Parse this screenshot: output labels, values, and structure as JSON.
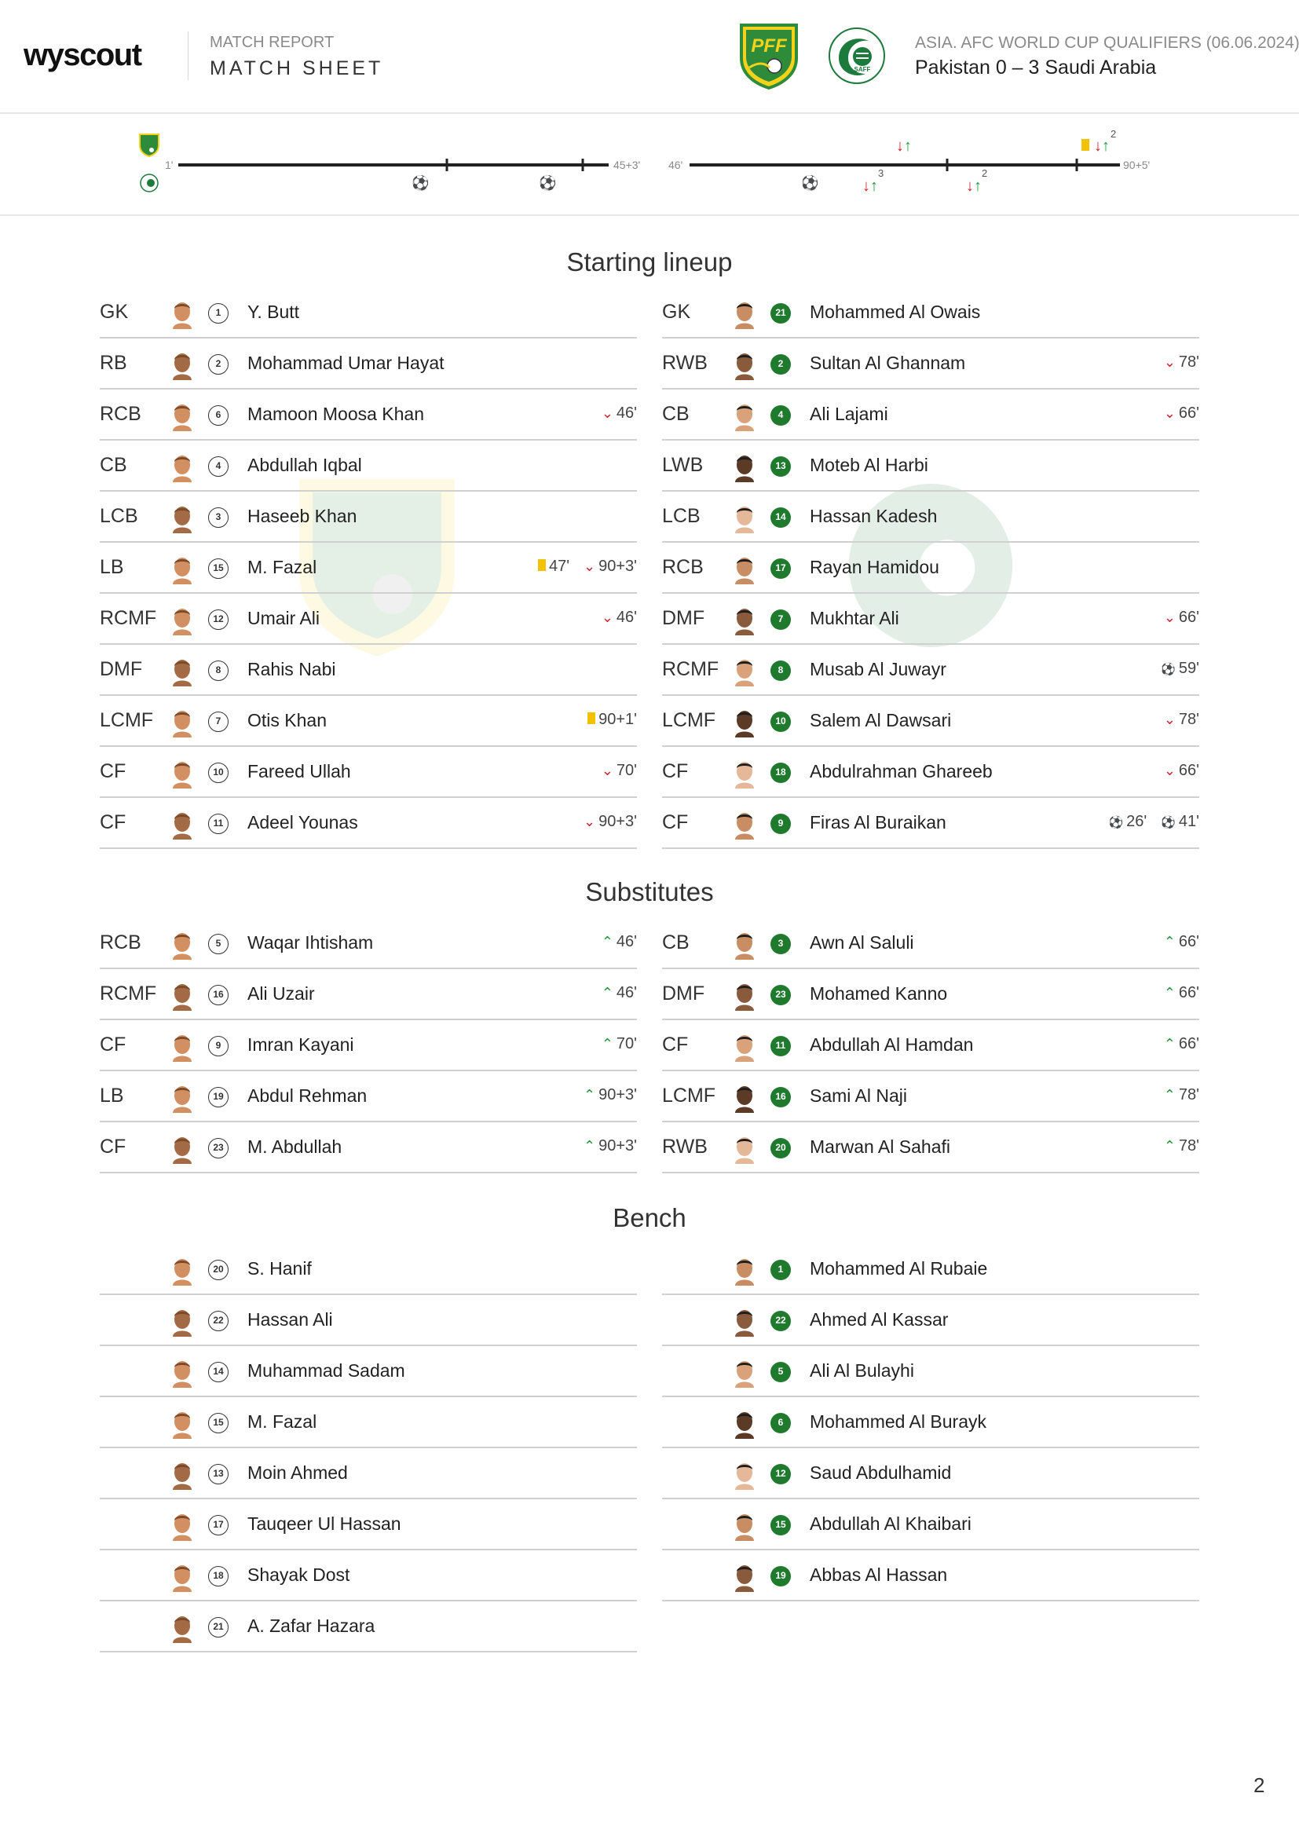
{
  "header": {
    "logo": "wyscout",
    "report_label": "MATCH REPORT",
    "sheet_title": "MATCH SHEET",
    "competition": "ASIA. AFC WORLD CUP QUALIFIERS (06.06.2024)",
    "result": "Pakistan 0 – 3 Saudi Arabia",
    "home_crest_text": "PFF",
    "away_crest_text": "SAFF"
  },
  "timeline": {
    "first_half": {
      "start": "1'",
      "end": "45+3'"
    },
    "second_half": {
      "start": "46'",
      "end": "90+5'"
    },
    "first_half_events": [
      {
        "team": "away",
        "type": "goal"
      },
      {
        "team": "away",
        "type": "goal"
      }
    ],
    "second_half_events": [
      {
        "team": "away",
        "type": "goal"
      },
      {
        "team": "away",
        "type": "substitution",
        "count": "3"
      },
      {
        "team": "home",
        "type": "substitution",
        "count": ""
      },
      {
        "team": "away",
        "type": "substitution",
        "count": "2"
      },
      {
        "team": "home",
        "type": "yellow-card",
        "count": ""
      },
      {
        "team": "home",
        "type": "substitution",
        "count": "2"
      }
    ]
  },
  "sections": {
    "starting": "Starting lineup",
    "substitutes": "Substitutes",
    "bench": "Bench"
  },
  "home": {
    "starting": [
      {
        "pos": "GK",
        "num": "1",
        "name": "Y. Butt",
        "events": []
      },
      {
        "pos": "RB",
        "num": "2",
        "name": "Mohammad Umar Hayat",
        "events": []
      },
      {
        "pos": "RCB",
        "num": "6",
        "name": "Mamoon Moosa Khan",
        "events": [
          {
            "type": "out",
            "time": "46'"
          }
        ]
      },
      {
        "pos": "CB",
        "num": "4",
        "name": "Abdullah Iqbal",
        "events": []
      },
      {
        "pos": "LCB",
        "num": "3",
        "name": "Haseeb Khan",
        "events": []
      },
      {
        "pos": "LB",
        "num": "15",
        "name": "M. Fazal",
        "events": [
          {
            "type": "yellow",
            "time": "47'"
          },
          {
            "type": "out",
            "time": "90+3'"
          }
        ]
      },
      {
        "pos": "RCMF",
        "num": "12",
        "name": "Umair Ali",
        "events": [
          {
            "type": "out",
            "time": "46'"
          }
        ]
      },
      {
        "pos": "DMF",
        "num": "8",
        "name": "Rahis Nabi",
        "events": []
      },
      {
        "pos": "LCMF",
        "num": "7",
        "name": "Otis Khan",
        "events": [
          {
            "type": "yellow",
            "time": "90+1'"
          }
        ]
      },
      {
        "pos": "CF",
        "num": "10",
        "name": "Fareed Ullah",
        "events": [
          {
            "type": "out",
            "time": "70'"
          }
        ]
      },
      {
        "pos": "CF",
        "num": "11",
        "name": "Adeel Younas",
        "events": [
          {
            "type": "out",
            "time": "90+3'"
          }
        ]
      }
    ],
    "substitutes": [
      {
        "pos": "RCB",
        "num": "5",
        "name": "Waqar Ihtisham",
        "events": [
          {
            "type": "in",
            "time": "46'"
          }
        ]
      },
      {
        "pos": "RCMF",
        "num": "16",
        "name": "Ali Uzair",
        "events": [
          {
            "type": "in",
            "time": "46'"
          }
        ]
      },
      {
        "pos": "CF",
        "num": "9",
        "name": "Imran Kayani",
        "events": [
          {
            "type": "in",
            "time": "70'"
          }
        ]
      },
      {
        "pos": "LB",
        "num": "19",
        "name": "Abdul Rehman",
        "events": [
          {
            "type": "in",
            "time": "90+3'"
          }
        ]
      },
      {
        "pos": "CF",
        "num": "23",
        "name": "M. Abdullah",
        "events": [
          {
            "type": "in",
            "time": "90+3'"
          }
        ]
      }
    ],
    "bench": [
      {
        "pos": "",
        "num": "20",
        "name": "S. Hanif",
        "events": []
      },
      {
        "pos": "",
        "num": "22",
        "name": "Hassan Ali",
        "events": []
      },
      {
        "pos": "",
        "num": "14",
        "name": "Muhammad Sadam",
        "events": []
      },
      {
        "pos": "",
        "num": "15",
        "name": "M. Fazal",
        "events": []
      },
      {
        "pos": "",
        "num": "13",
        "name": "Moin Ahmed",
        "events": []
      },
      {
        "pos": "",
        "num": "17",
        "name": "Tauqeer Ul Hassan",
        "events": []
      },
      {
        "pos": "",
        "num": "18",
        "name": "Shayak Dost",
        "events": []
      },
      {
        "pos": "",
        "num": "21",
        "name": "A. Zafar Hazara",
        "events": []
      }
    ]
  },
  "away": {
    "starting": [
      {
        "pos": "GK",
        "num": "21",
        "name": "Mohammed Al Owais",
        "events": []
      },
      {
        "pos": "RWB",
        "num": "2",
        "name": "Sultan Al Ghannam",
        "events": [
          {
            "type": "out",
            "time": "78'"
          }
        ]
      },
      {
        "pos": "CB",
        "num": "4",
        "name": "Ali Lajami",
        "events": [
          {
            "type": "out",
            "time": "66'"
          }
        ]
      },
      {
        "pos": "LWB",
        "num": "13",
        "name": "Moteb Al Harbi",
        "events": []
      },
      {
        "pos": "LCB",
        "num": "14",
        "name": "Hassan Kadesh",
        "events": []
      },
      {
        "pos": "RCB",
        "num": "17",
        "name": "Rayan Hamidou",
        "events": []
      },
      {
        "pos": "DMF",
        "num": "7",
        "name": "Mukhtar Ali",
        "events": [
          {
            "type": "out",
            "time": "66'"
          }
        ]
      },
      {
        "pos": "RCMF",
        "num": "8",
        "name": "Musab Al Juwayr",
        "events": [
          {
            "type": "goal",
            "time": "59'"
          }
        ]
      },
      {
        "pos": "LCMF",
        "num": "10",
        "name": "Salem Al Dawsari",
        "events": [
          {
            "type": "out",
            "time": "78'"
          }
        ]
      },
      {
        "pos": "CF",
        "num": "18",
        "name": "Abdulrahman Ghareeb",
        "events": [
          {
            "type": "out",
            "time": "66'"
          }
        ]
      },
      {
        "pos": "CF",
        "num": "9",
        "name": "Firas Al Buraikan",
        "events": [
          {
            "type": "goal",
            "time": "26'"
          },
          {
            "type": "goal",
            "time": "41'"
          }
        ]
      }
    ],
    "substitutes": [
      {
        "pos": "CB",
        "num": "3",
        "name": "Awn Al Saluli",
        "events": [
          {
            "type": "in",
            "time": "66'"
          }
        ]
      },
      {
        "pos": "DMF",
        "num": "23",
        "name": "Mohamed Kanno",
        "events": [
          {
            "type": "in",
            "time": "66'"
          }
        ]
      },
      {
        "pos": "CF",
        "num": "11",
        "name": "Abdullah Al Hamdan",
        "events": [
          {
            "type": "in",
            "time": "66'"
          }
        ]
      },
      {
        "pos": "LCMF",
        "num": "16",
        "name": "Sami Al Naji",
        "events": [
          {
            "type": "in",
            "time": "78'"
          }
        ]
      },
      {
        "pos": "RWB",
        "num": "20",
        "name": "Marwan Al Sahafi",
        "events": [
          {
            "type": "in",
            "time": "78'"
          }
        ]
      }
    ],
    "bench": [
      {
        "pos": "",
        "num": "1",
        "name": "Mohammed Al Rubaie",
        "events": []
      },
      {
        "pos": "",
        "num": "22",
        "name": "Ahmed Al Kassar",
        "events": []
      },
      {
        "pos": "",
        "num": "5",
        "name": "Ali Al Bulayhi",
        "events": []
      },
      {
        "pos": "",
        "num": "6",
        "name": "Mohammed Al Burayk",
        "events": []
      },
      {
        "pos": "",
        "num": "12",
        "name": "Saud Abdulhamid",
        "events": []
      },
      {
        "pos": "",
        "num": "15",
        "name": "Abdullah Al Khaibari",
        "events": []
      },
      {
        "pos": "",
        "num": "19",
        "name": "Abbas Al Hassan",
        "events": []
      }
    ]
  },
  "page_number": "2",
  "colors": {
    "away_number_bg": "#1f7a2e",
    "yellow_card": "#f2c200",
    "sub_out": "#d0242e",
    "sub_in": "#1f9a3a",
    "pff_green": "#2e8b3a",
    "pff_yellow": "#f4d21c"
  }
}
